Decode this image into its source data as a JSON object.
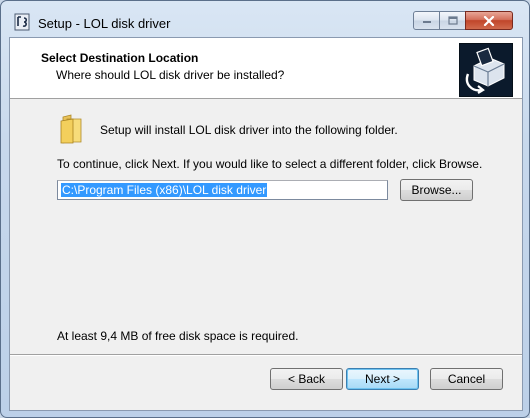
{
  "window": {
    "title": "Setup - LOL disk driver"
  },
  "header": {
    "title": "Select Destination Location",
    "subtitle": "Where should LOL disk driver be installed?",
    "logo_icon": "installer-disk-icon"
  },
  "content": {
    "folder_icon": "folder-icon",
    "intro": "Setup will install LOL disk driver into the following folder.",
    "instruction": "To continue, click Next. If you would like to select a different folder, click Browse.",
    "path_value": "C:\\Program Files (x86)\\LOL disk driver",
    "browse_label": "Browse...",
    "space_required": "At least 9,4 MB of free disk space is required."
  },
  "footer": {
    "back_label": "< Back",
    "next_label": "Next >",
    "cancel_label": "Cancel"
  },
  "colors": {
    "selection": "#3399ff",
    "close_button": "#c0452a",
    "logo_background": "#0b1a2c"
  }
}
